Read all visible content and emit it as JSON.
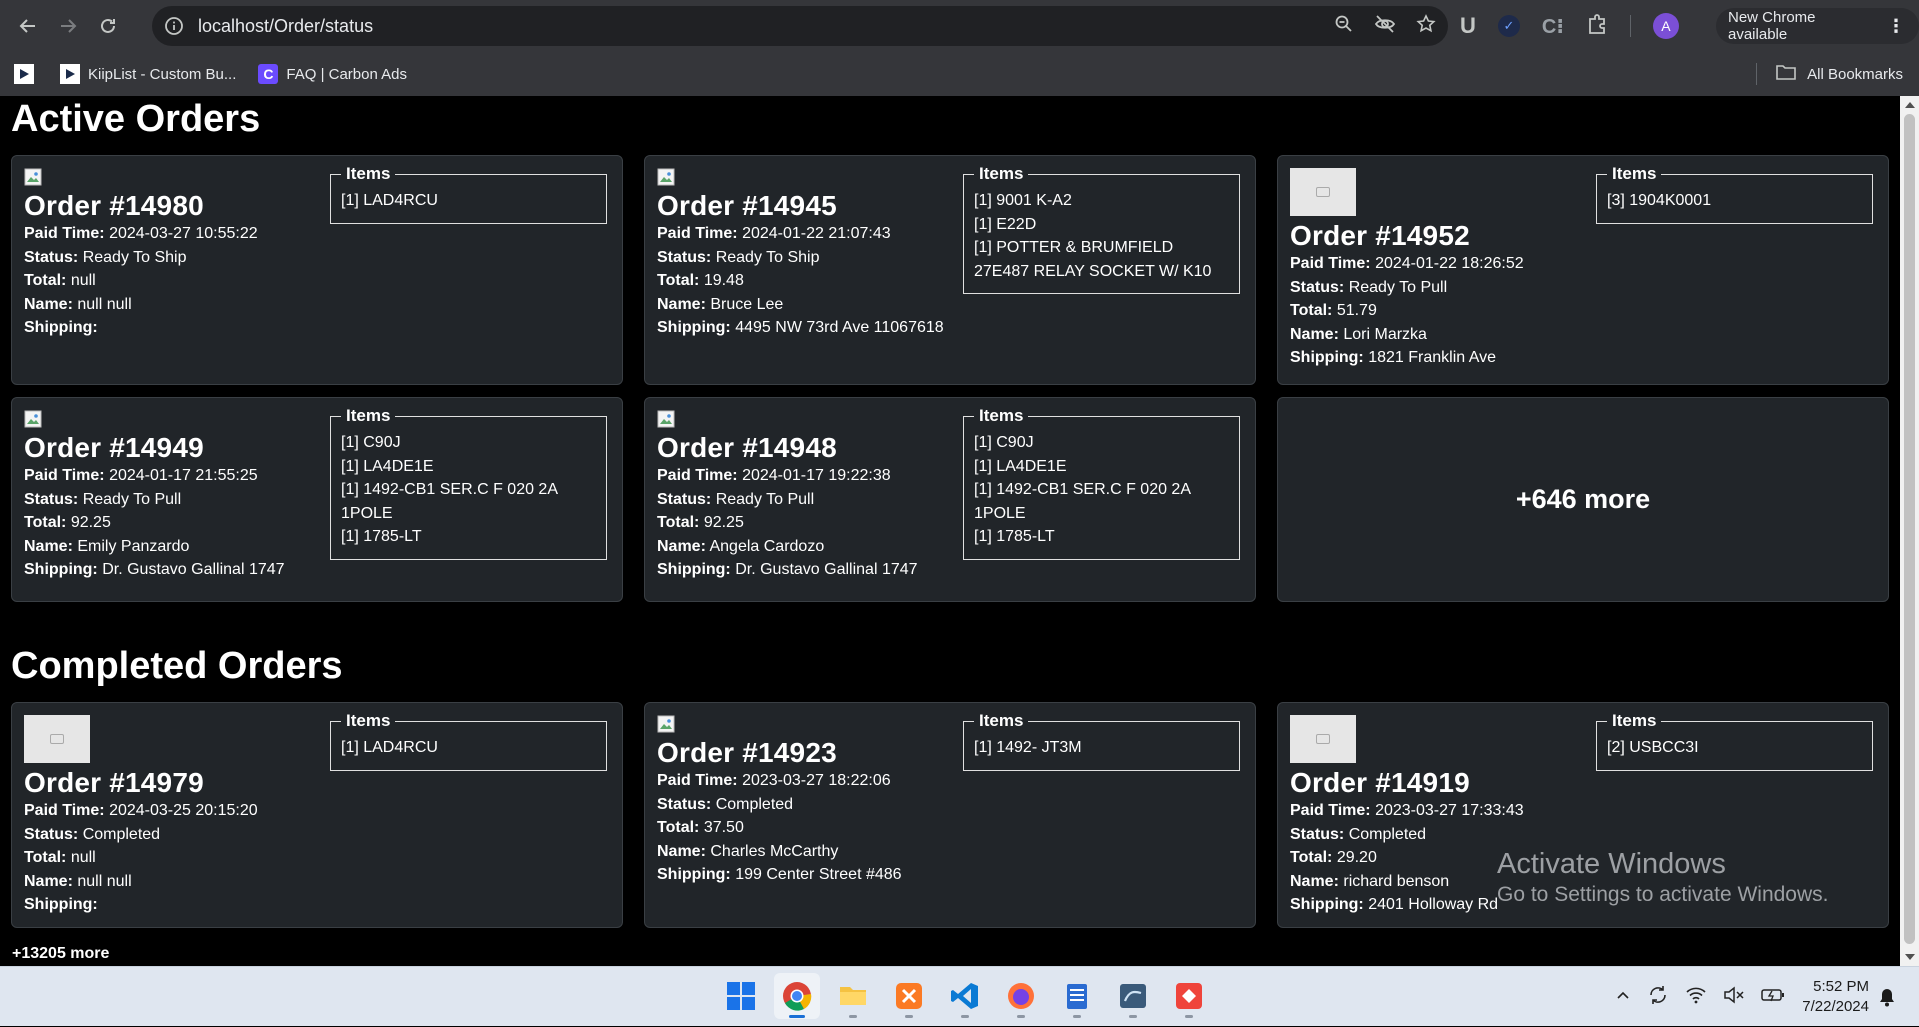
{
  "browser": {
    "url": "localhost/Order/status",
    "new_chrome_label": "New Chrome available",
    "avatar_letter": "A",
    "bookmarks": [
      {
        "label": ""
      },
      {
        "label": "KiipList - Custom Bu..."
      },
      {
        "label": "FAQ | Carbon Ads"
      }
    ],
    "all_bookmarks_label": "All Bookmarks"
  },
  "active_section": {
    "title": "Active Orders",
    "orders": [
      {
        "title": "Order #14980",
        "image": "broken",
        "paid_label": "Paid Time:",
        "paid": "2024-03-27 10:55:22",
        "status_label": "Status:",
        "status": "Ready To Ship",
        "total_label": "Total:",
        "total": "null",
        "name_label": "Name:",
        "name": "null null",
        "shipping_label": "Shipping:",
        "shipping": "",
        "items_label": "Items",
        "items": [
          "[1] LAD4RCU"
        ]
      },
      {
        "title": "Order #14945",
        "image": "broken",
        "paid_label": "Paid Time:",
        "paid": "2024-01-22 21:07:43",
        "status_label": "Status:",
        "status": "Ready To Ship",
        "total_label": "Total:",
        "total": "19.48",
        "name_label": "Name:",
        "name": "Bruce Lee",
        "shipping_label": "Shipping:",
        "shipping": "4495 NW 73rd Ave 11067618",
        "items_label": "Items",
        "items": [
          "[1] 9001 K-A2",
          "[1] E22D",
          "[1] POTTER & BRUMFIELD 27E487 RELAY SOCKET W/ K10"
        ]
      },
      {
        "title": "Order #14952",
        "image": "no-image",
        "paid_label": "Paid Time:",
        "paid": "2024-01-22 18:26:52",
        "status_label": "Status:",
        "status": "Ready To Pull",
        "total_label": "Total:",
        "total": "51.79",
        "name_label": "Name:",
        "name": "Lori Marzka",
        "shipping_label": "Shipping:",
        "shipping": "1821 Franklin Ave",
        "items_label": "Items",
        "items": [
          "[3] 1904K0001"
        ]
      },
      {
        "title": "Order #14949",
        "image": "broken",
        "paid_label": "Paid Time:",
        "paid": "2024-01-17 21:55:25",
        "status_label": "Status:",
        "status": "Ready To Pull",
        "total_label": "Total:",
        "total": "92.25",
        "name_label": "Name:",
        "name": "Emily Panzardo",
        "shipping_label": "Shipping:",
        "shipping": "Dr. Gustavo Gallinal 1747",
        "items_label": "Items",
        "items": [
          "[1] C90J",
          "[1] LA4DE1E",
          "[1] 1492-CB1 SER.C F 020 2A 1POLE",
          "[1] 1785-LT"
        ]
      },
      {
        "title": "Order #14948",
        "image": "broken",
        "paid_label": "Paid Time:",
        "paid": "2024-01-17 19:22:38",
        "status_label": "Status:",
        "status": "Ready To Pull",
        "total_label": "Total:",
        "total": "92.25",
        "name_label": "Name:",
        "name": "Angela Cardozo",
        "shipping_label": "Shipping:",
        "shipping": "Dr. Gustavo Gallinal 1747",
        "items_label": "Items",
        "items": [
          "[1] C90J",
          "[1] LA4DE1E",
          "[1] 1492-CB1 SER.C F 020 2A 1POLE",
          "[1] 1785-LT"
        ]
      }
    ],
    "more_label": "+646 more"
  },
  "completed_section": {
    "title": "Completed Orders",
    "orders": [
      {
        "title": "Order #14979",
        "image": "no-image",
        "paid_label": "Paid Time:",
        "paid": "2024-03-25 20:15:20",
        "status_label": "Status:",
        "status": "Completed",
        "total_label": "Total:",
        "total": "null",
        "name_label": "Name:",
        "name": "null null",
        "shipping_label": "Shipping:",
        "shipping": "",
        "items_label": "Items",
        "items": [
          "[1] LAD4RCU"
        ]
      },
      {
        "title": "Order #14923",
        "image": "broken",
        "paid_label": "Paid Time:",
        "paid": "2023-03-27 18:22:06",
        "status_label": "Status:",
        "status": "Completed",
        "total_label": "Total:",
        "total": "37.50",
        "name_label": "Name:",
        "name": "Charles McCarthy",
        "shipping_label": "Shipping:",
        "shipping": "199 Center Street #486",
        "items_label": "Items",
        "items": [
          "[1] 1492- JT3M"
        ]
      },
      {
        "title": "Order #14919",
        "image": "no-image",
        "paid_label": "Paid Time:",
        "paid": "2023-03-27 17:33:43",
        "status_label": "Status:",
        "status": "Completed",
        "total_label": "Total:",
        "total": "29.20",
        "name_label": "Name:",
        "name": "richard benson",
        "shipping_label": "Shipping:",
        "shipping": "2401 Holloway Rd",
        "items_label": "Items",
        "items": [
          "[2] USBCC3I"
        ]
      }
    ],
    "more_label": "+13205 more"
  },
  "watermark": {
    "line1": "Activate Windows",
    "line2": "Go to Settings to activate Windows."
  },
  "taskbar": {
    "apps": [
      "windows-start",
      "chrome",
      "file-explorer",
      "xampp",
      "vscode",
      "firefox",
      "notepad",
      "mysql-workbench",
      "anydesk"
    ],
    "active_app": "chrome",
    "time": "5:52 PM",
    "date": "7/22/2024"
  },
  "colors": {
    "card_bg": "#212529",
    "page_bg": "#000000",
    "chrome_bg": "#35363a",
    "taskbar_bg": "#dfe6f0"
  }
}
